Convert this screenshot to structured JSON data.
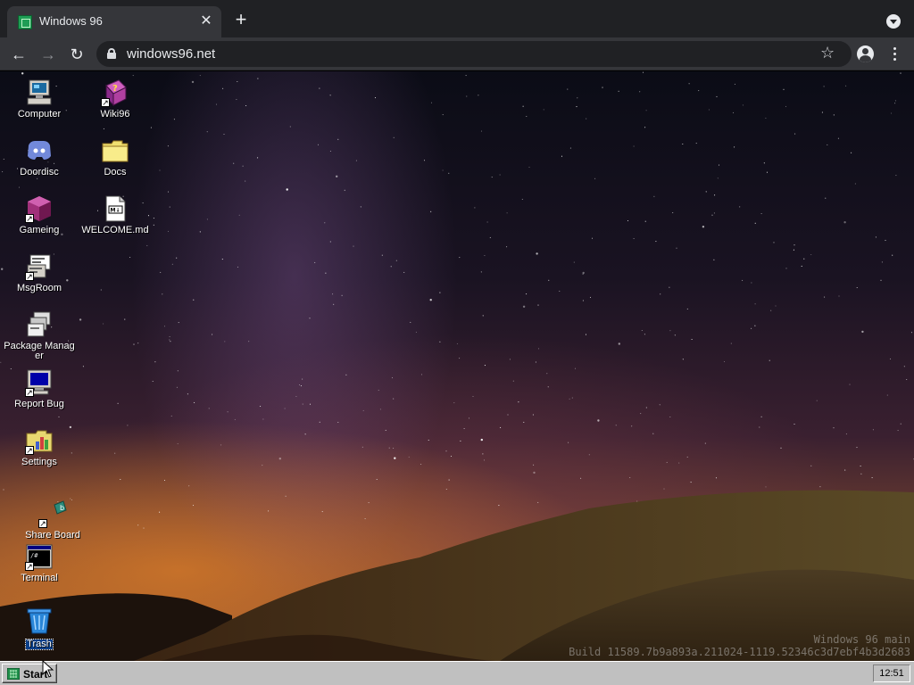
{
  "browser": {
    "tab_title": "Windows 96",
    "tab_close": "✕",
    "new_tab": "+",
    "back": "←",
    "forward": "→",
    "reload": "↻",
    "url": "windows96.net",
    "bookmark": "☆"
  },
  "desktop": {
    "icons": [
      {
        "id": "computer",
        "label": "Computer",
        "icon": "computer-icon"
      },
      {
        "id": "doordisc",
        "label": "Doordisc",
        "icon": "discord-icon"
      },
      {
        "id": "gameing",
        "label": "Gameing",
        "icon": "cube-icon"
      },
      {
        "id": "msgroom",
        "label": "MsgRoom",
        "icon": "chat-icon"
      },
      {
        "id": "package-manager",
        "label": "Package Manager",
        "icon": "package-icon"
      },
      {
        "id": "report-bug",
        "label": "Report Bug",
        "icon": "monitor-icon"
      },
      {
        "id": "settings",
        "label": "Settings",
        "icon": "settings-folder-icon"
      },
      {
        "id": "share-board",
        "label": "Share Board",
        "icon": "share-board-icon"
      },
      {
        "id": "terminal",
        "label": "Terminal",
        "icon": "terminal-icon"
      },
      {
        "id": "trash",
        "label": "Trash",
        "icon": "trash-icon"
      },
      {
        "id": "wiki96",
        "label": "Wiki96",
        "icon": "book-icon"
      },
      {
        "id": "docs",
        "label": "Docs",
        "icon": "folder-icon"
      },
      {
        "id": "welcome",
        "label": "WELCOME.md",
        "icon": "markdown-file-icon"
      }
    ],
    "watermark_line1": "Windows 96 main",
    "watermark_line2": "Build 11589.7b9a893a.211024-1119.52346c3d7ebf4b3d2683"
  },
  "taskbar": {
    "start_label": "Start",
    "clock": "12:51"
  },
  "colors": {
    "selection": "#0a3f8a",
    "taskbar": "#c0c0c0",
    "chrome_dark": "#202124",
    "chrome_toolbar": "#35363a"
  }
}
